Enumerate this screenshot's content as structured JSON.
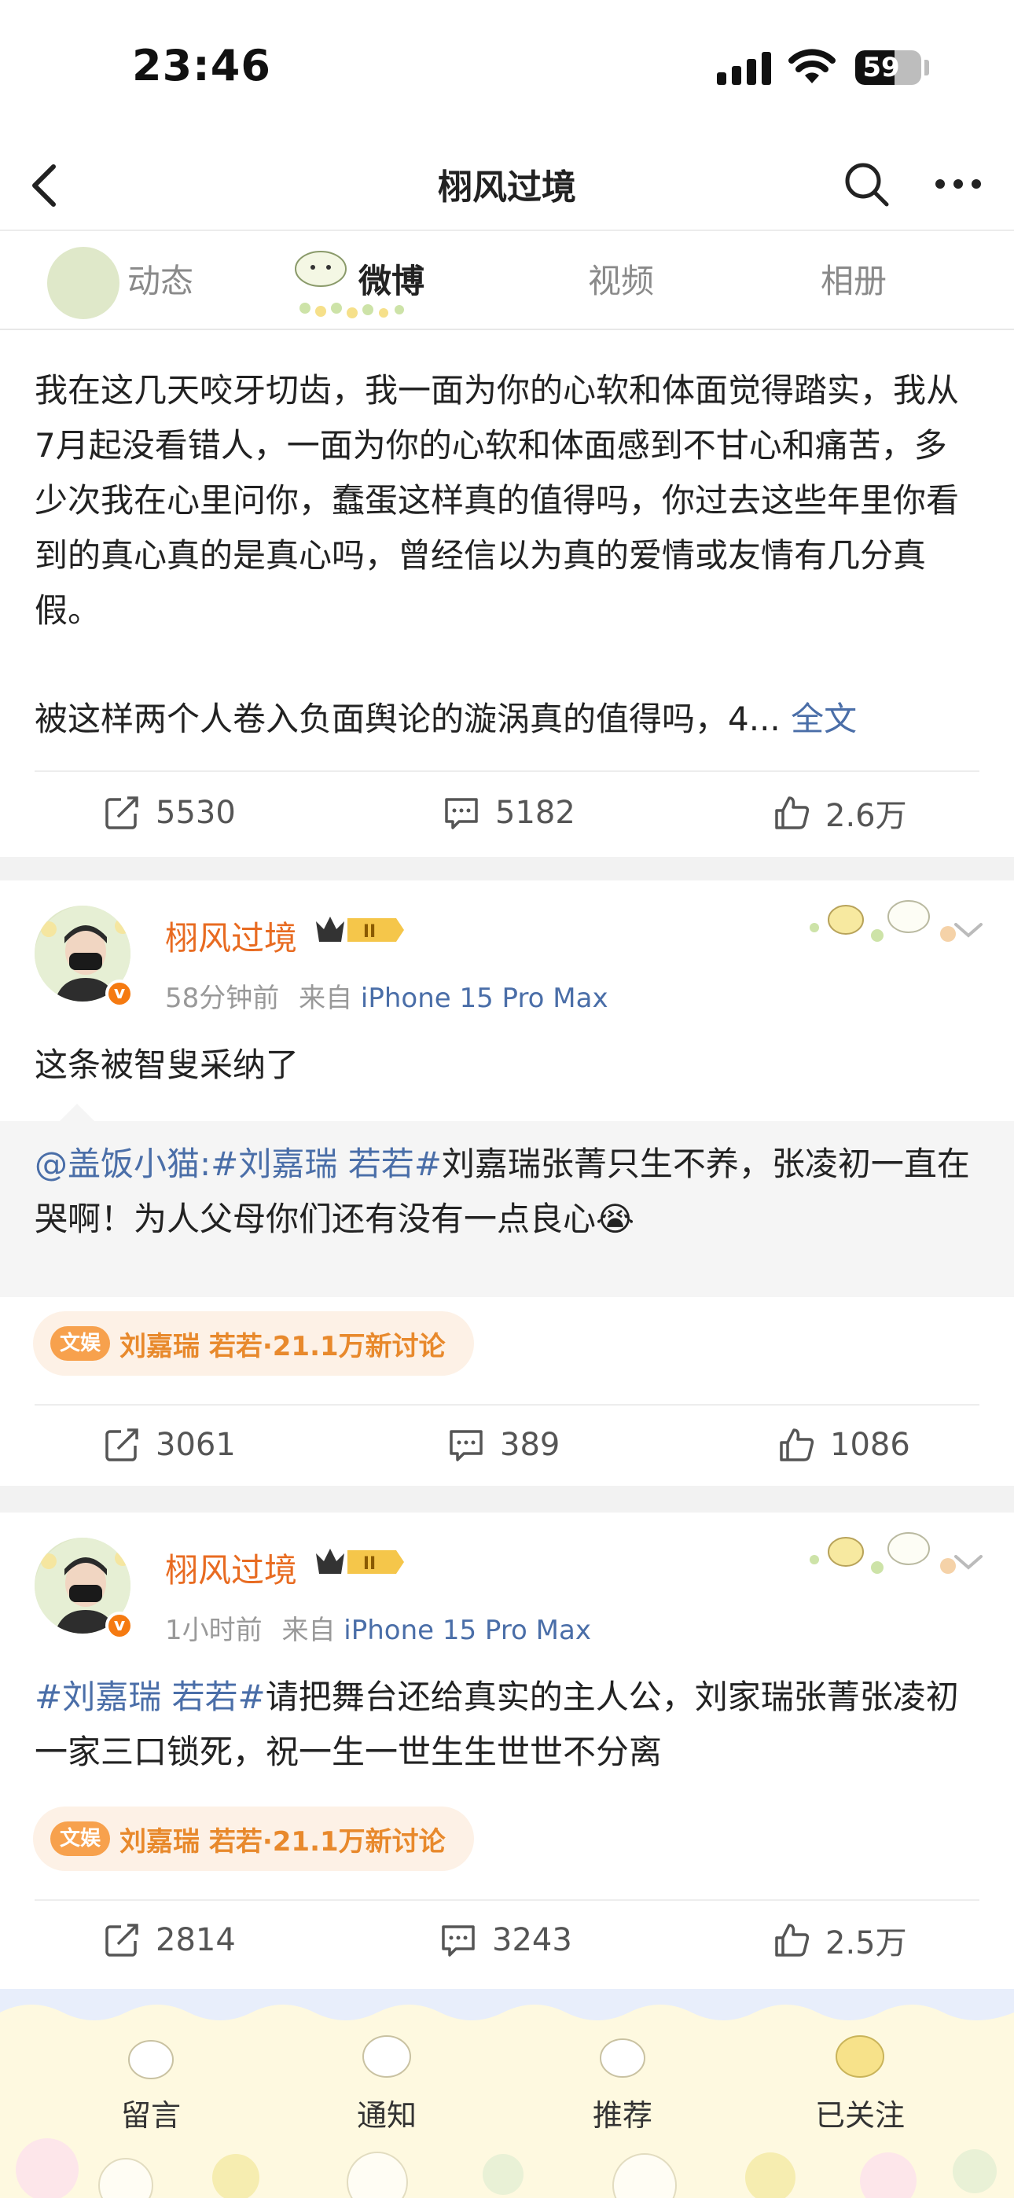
{
  "status_bar": {
    "time": "23:46",
    "battery": "59",
    "battery_level": 0.59
  },
  "nav": {
    "title": "栩风过境"
  },
  "tabs": [
    {
      "label": "动态",
      "active": false
    },
    {
      "label": "微博",
      "active": true
    },
    {
      "label": "视频",
      "active": false
    },
    {
      "label": "相册",
      "active": false
    }
  ],
  "post1": {
    "text": "我在这几天咬牙切齿，我一面为你的心软和体面觉得踏实，我从7月起没看错人，一面为你的心软和体面感到不甘心和痛苦，多少次我在心里问你，蠢蛋这样真的值得吗，你过去这些年里你看到的真心真的是真心吗，曾经信以为真的爱情或友情有几分真假。",
    "text2": "被这样两个人卷入负面舆论的漩涡真的值得吗，4...",
    "full_link": "全文",
    "reposts": "5530",
    "comments": "5182",
    "likes": "2.6万"
  },
  "post2": {
    "username": "栩风过境",
    "time": "58分钟前",
    "source_prefix": "来自",
    "device": "iPhone 15 Pro Max",
    "text": "这条被智叟采纳了",
    "quote_user": "@盖饭小猫:",
    "quote_tag": "#刘嘉瑞 若若#",
    "quote_text": "刘嘉瑞张菁只生不养，张凌初一直在哭啊！为人父母你们还有没有一点良心",
    "quote_emoji": "😭",
    "topic_icon": "文娱",
    "topic": "刘嘉瑞 若若·21.1万新讨论",
    "reposts": "3061",
    "comments": "389",
    "likes": "1086"
  },
  "post3": {
    "username": "栩风过境",
    "time": "1小时前",
    "source_prefix": "来自",
    "device": "iPhone 15 Pro Max",
    "tag": "#刘嘉瑞 若若#",
    "text": "请把舞台还给真实的主人公，刘家瑞张菁张凌初一家三口锁死，祝一生一世生生世世不分离",
    "topic_icon": "文娱",
    "topic": "刘嘉瑞 若若·21.1万新讨论",
    "reposts": "2814",
    "comments": "3243",
    "likes": "2.5万"
  },
  "bottom_bar": [
    {
      "label": "留言"
    },
    {
      "label": "通知"
    },
    {
      "label": "推荐"
    },
    {
      "label": "已关注"
    }
  ],
  "colors": {
    "link": "#4a6ea8",
    "username": "#e86b21",
    "topic": "#e8892c"
  }
}
